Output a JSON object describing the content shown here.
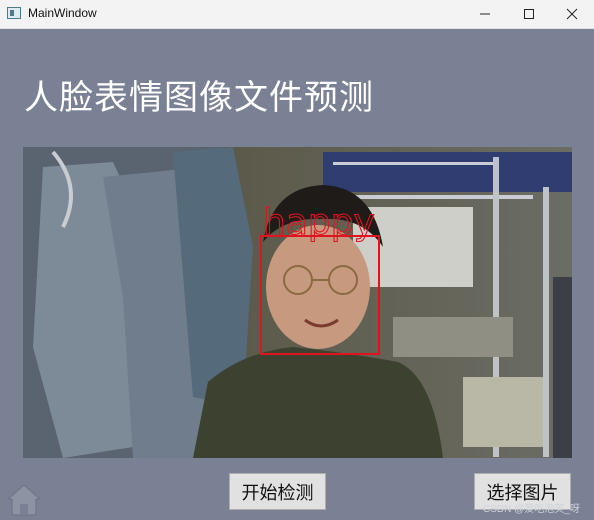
{
  "window": {
    "title": "MainWindow",
    "minimize_glyph": "—",
    "maximize_glyph": "☐",
    "close_glyph": "✕"
  },
  "main": {
    "title": "人脸表情图像文件预测"
  },
  "detection": {
    "label": "happy",
    "box_color": "#e0141e"
  },
  "buttons": {
    "start_label": "开始检测",
    "select_label": "选择图片"
  },
  "icons": {
    "home": "home-icon"
  },
  "watermark": "CSDN @爱吃泡芙_呀",
  "colors": {
    "background": "#7b8194",
    "titlebar": "#f3f3f3"
  }
}
